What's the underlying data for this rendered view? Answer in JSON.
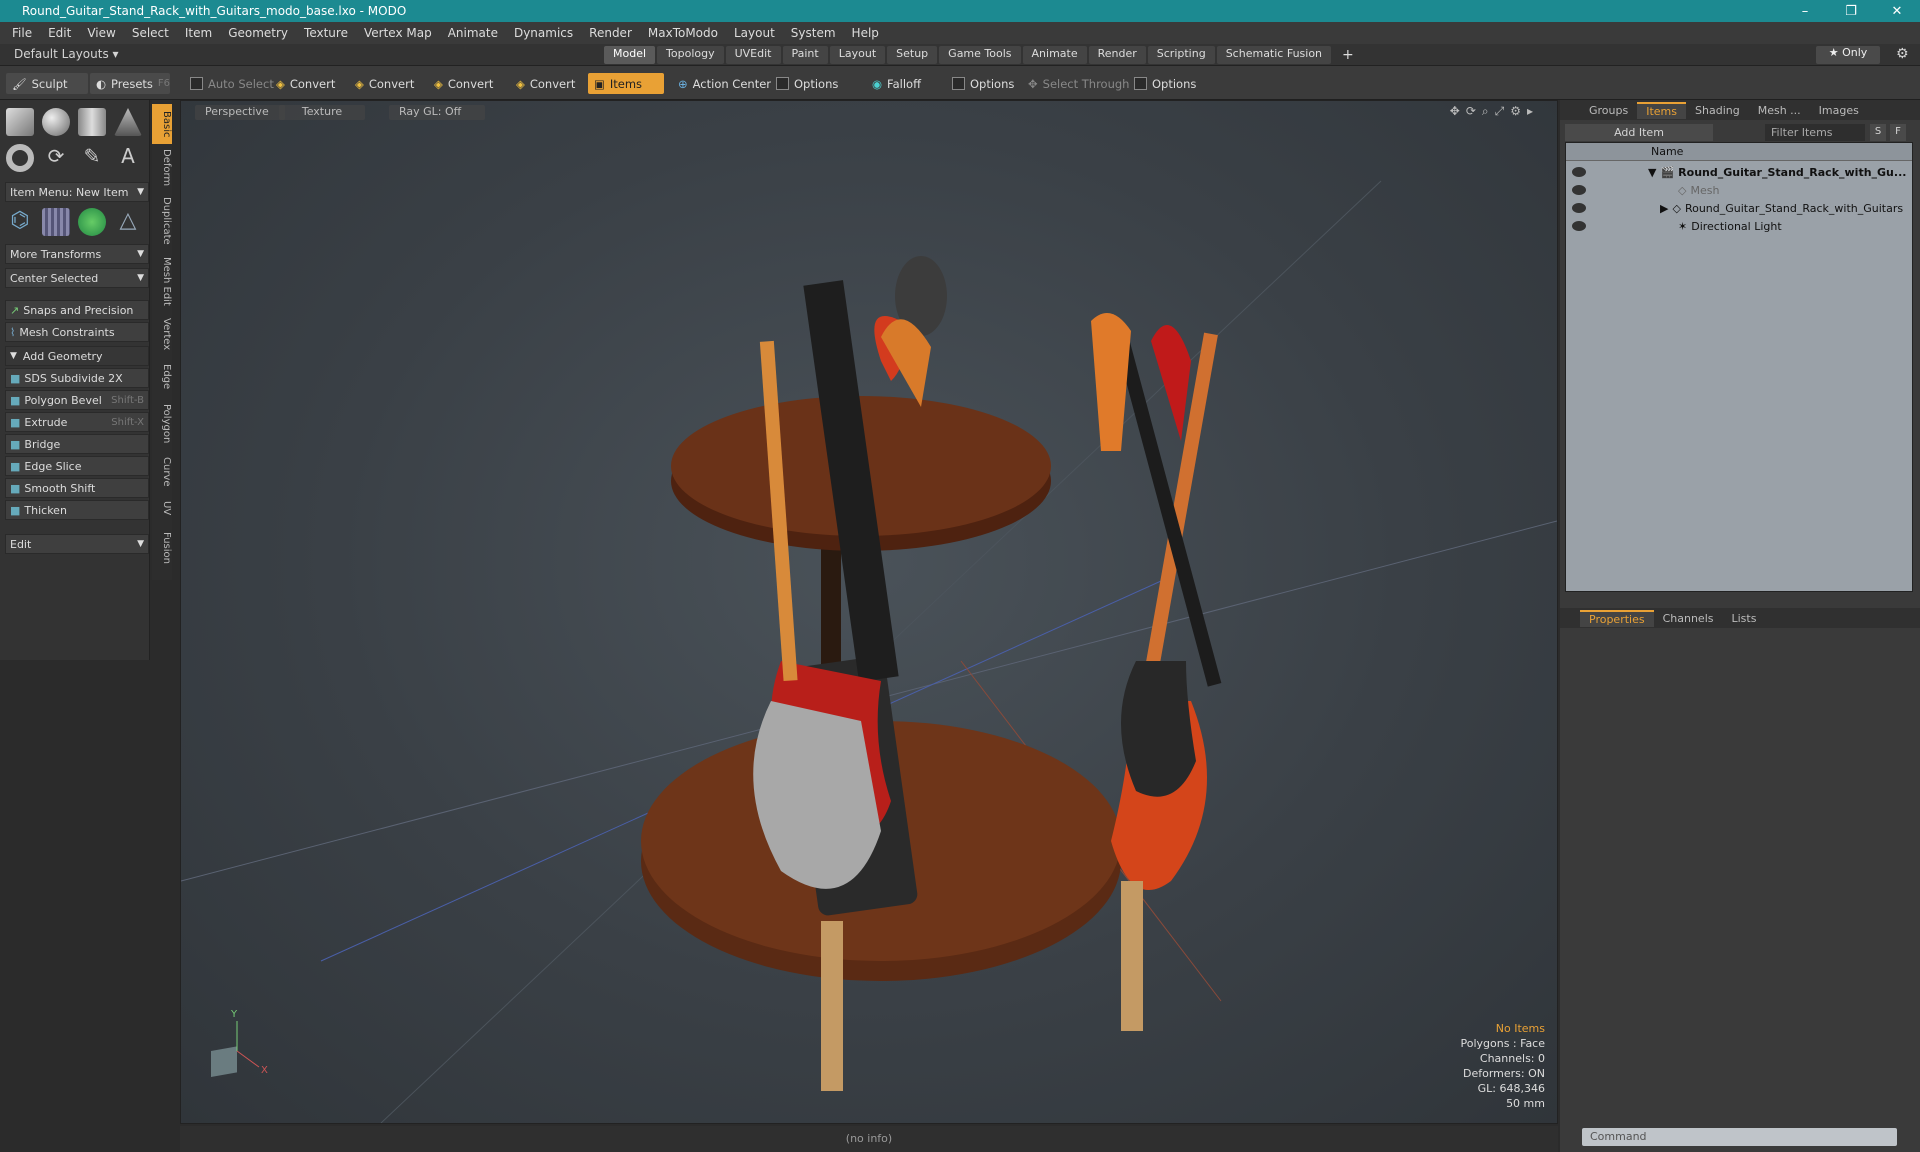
{
  "window": {
    "title": "Round_Guitar_Stand_Rack_with_Guitars_modo_base.lxo - MODO",
    "min": "–",
    "max": "❐",
    "close": "✕"
  },
  "menu": [
    "File",
    "Edit",
    "View",
    "Select",
    "Item",
    "Geometry",
    "Texture",
    "Vertex Map",
    "Animate",
    "Dynamics",
    "Render",
    "MaxToModo",
    "Layout",
    "System",
    "Help"
  ],
  "layout": {
    "default_layouts": "Default Layouts ▾",
    "tabs": [
      "Model",
      "Topology",
      "UVEdit",
      "Paint",
      "Layout",
      "Setup",
      "Game Tools",
      "Animate",
      "Render",
      "Scripting",
      "Schematic Fusion"
    ],
    "active": "Model",
    "add": "+",
    "only": "★ Only"
  },
  "toolbar": {
    "sculpt": "Sculpt",
    "presets": "Presets",
    "presets_key": "F6",
    "auto_select": "Auto Select",
    "convert1": "Convert",
    "convert2": "Convert",
    "convert3": "Convert",
    "convert4": "Convert",
    "items": "Items",
    "action_center": "Action Center",
    "options1": "Options",
    "falloff": "Falloff",
    "options2": "Options",
    "select_through": "Select Through",
    "options3": "Options"
  },
  "left": {
    "item_menu": "Item Menu: New Item",
    "more_transforms": "More Transforms",
    "center_selected": "Center Selected",
    "snaps": "Snaps and Precision",
    "mesh_constraints": "Mesh Constraints",
    "add_geometry": "Add Geometry",
    "tools": [
      {
        "label": "SDS Subdivide 2X",
        "key": ""
      },
      {
        "label": "Polygon Bevel",
        "key": "Shift-B"
      },
      {
        "label": "Extrude",
        "key": "Shift-X"
      },
      {
        "label": "Bridge",
        "key": ""
      },
      {
        "label": "Edge Slice",
        "key": ""
      },
      {
        "label": "Smooth Shift",
        "key": ""
      },
      {
        "label": "Thicken",
        "key": ""
      }
    ],
    "edit": "Edit"
  },
  "vtabs": [
    "Basic",
    "Deform",
    "Duplicate",
    "Mesh Edit",
    "Vertex",
    "Edge",
    "Polygon",
    "Curve",
    "UV",
    "Fusion"
  ],
  "viewport": {
    "perspective": "Perspective",
    "texture": "Texture",
    "raygl": "Ray GL: Off",
    "stats": {
      "no_items": "No Items",
      "polygons": "Polygons : Face",
      "channels": "Channels: 0",
      "deformers": "Deformers: ON",
      "gl": "GL: 648,346",
      "size": "50 mm"
    },
    "axis_y": "Y",
    "axis_x": "X"
  },
  "status": "(no info)",
  "right": {
    "tabs_top": [
      "Groups",
      "Items",
      "Shading",
      "Mesh ...",
      "Images"
    ],
    "active_top": "Items",
    "add_item": "Add Item",
    "filter": "Filter Items",
    "s": "S",
    "f": "F",
    "col_name": "Name",
    "rows": [
      "Round_Guitar_Stand_Rack_with_Gu...",
      "Mesh",
      "Round_Guitar_Stand_Rack_with_Guitars",
      "Directional Light"
    ],
    "tabs_bottom": [
      "Properties",
      "Channels",
      "Lists"
    ],
    "active_bottom": "Properties",
    "command": "Command"
  }
}
